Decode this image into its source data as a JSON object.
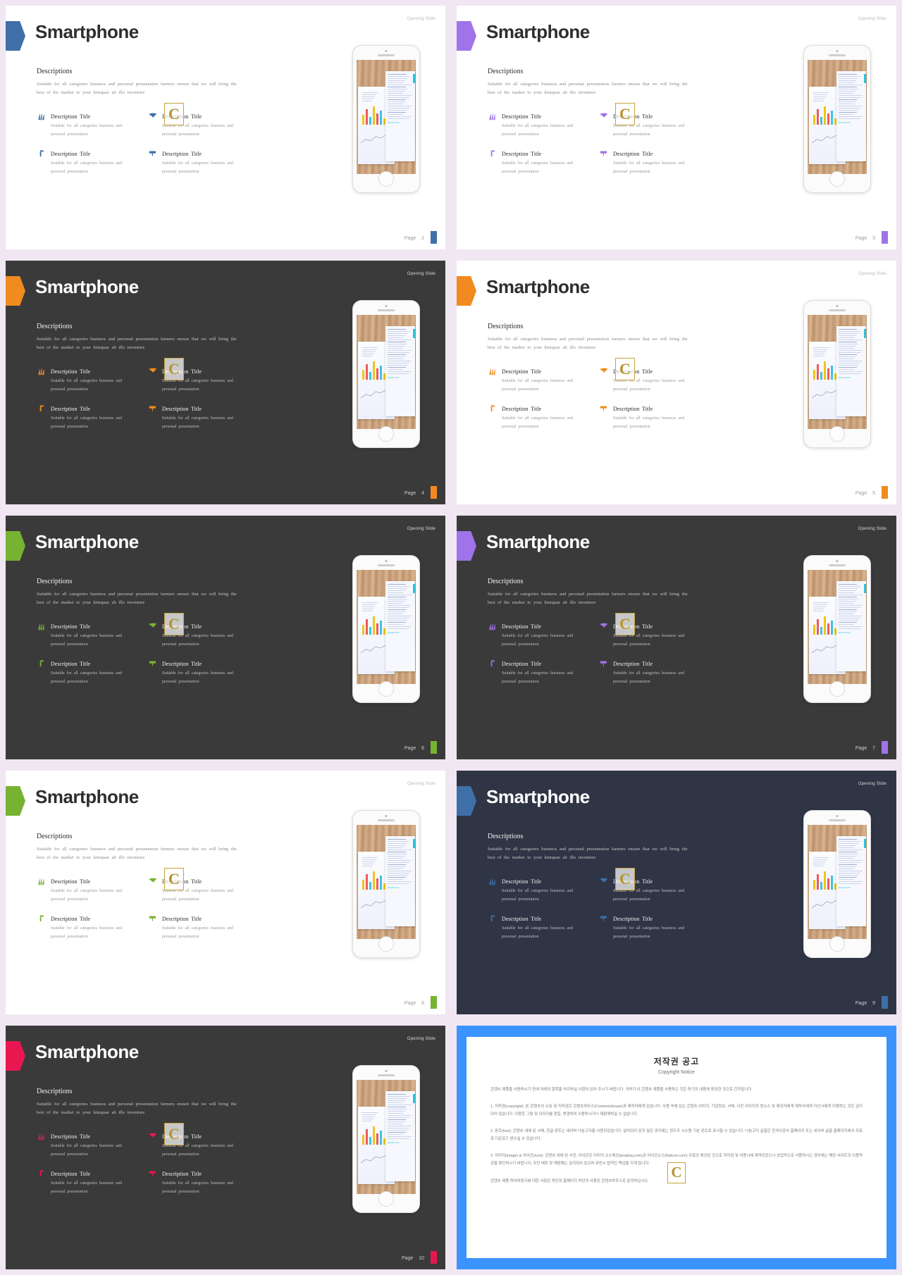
{
  "deck": {
    "slide_title": "Smartphone",
    "opening_tag": "Opening Slide",
    "descriptions_heading": "Descriptions",
    "descriptions_body": "Suitable for all categories  business and personal presentation  farmers ensure that we will  bring the best of the market to your kimquae ab illo inventore",
    "feature_title": "Description Title",
    "feature_body": "Suitable for all categories  business and personal  presentation",
    "watermark_letter": "C",
    "page_word": "Page",
    "feature_icons": [
      "grass-icon",
      "leaf-flag-icon",
      "faucet-icon",
      "paint-roller-icon"
    ]
  },
  "slides": [
    {
      "page": "2",
      "theme": "light",
      "accent": "#3f6fa8",
      "background": "#ffffff"
    },
    {
      "page": "3",
      "theme": "light",
      "accent": "#a073e8",
      "background": "#ffffff"
    },
    {
      "page": "4",
      "theme": "dark",
      "accent": "#f18b1f",
      "background": "#3a3a3a"
    },
    {
      "page": "5",
      "theme": "light",
      "accent": "#f18b1f",
      "background": "#ffffff"
    },
    {
      "page": "6",
      "theme": "dark",
      "accent": "#77b332",
      "background": "#3a3a3a"
    },
    {
      "page": "7",
      "theme": "dark",
      "accent": "#a073e8",
      "background": "#3a3a3a"
    },
    {
      "page": "8",
      "theme": "light",
      "accent": "#77b332",
      "background": "#ffffff"
    },
    {
      "page": "9",
      "theme": "navy",
      "accent": "#3f6fa8",
      "background": "#2f3545"
    },
    {
      "page": "10",
      "theme": "dark",
      "accent": "#e8174f",
      "background": "#3a3a3a"
    }
  ],
  "copyright_slide": {
    "frame_color": "#3b93ff",
    "title_ko": "저작권 공고",
    "title_en": "Copyright Notice",
    "watermark_letter": "C",
    "paragraphs": [
      "콘텐츠 제품을 사용하시기 전에 아래의 항목을 숙지하실 사항이 있어 주시기 바랍니다. 귀하가 이 콘텐츠 제품을 사용하는 것은 하기의 내용에 동의한 것으로 간주됩니다.",
      "1. 저작권(copyright): 본 콘텐츠의 소유 및 저작권은 콘텐츠하우스(ContentsHouse)과 제작자에게 있습니다. 사용 속에 있는 콘텐츠 이미지, 기업정보, 서체, 사진 이미지의 원소스 및 제공자에게 제작사에게 자산시에게 이용하는 것은 금지되어 있습니다. 이용한 그림 및 이미지를 편집, 변경하여 사용하시거나 재판매하실 수 없습니다.",
      "2. 폰트(font): 콘텐츠 내에 된 서체, 한글 폰트는 네이버 나눔고딕을 사용되었습니다. 설치되어 있지 않은 경우에는 윈도우 시스템 기본 폰트로 표시될 수 있습니다. 나눔고딕 글꼴은 한국어공사 홈페이지 또는 네이버 글꼴 홈페이지에서 무료로 다운로드 받으실 수 있습니다.",
      "3. 이미지(image) & 아이콘(icon): 콘텐츠 내에 된 사진, 아이콘은 이미지 소스제공(pixabay.com)과 아이콘소스(flaticon.com) 무료의 제공된 것으로 저작권 및 이용시에 제약되었으나 상업적으로 사용하시는 경우에는 해당 사이트의 이용약관을 확인하시기 바랍니다. 무단 배포 및 재판매는 금지되어 있으며 위반시 법적인 책임을 지게 됩니다.",
      "콘텐츠 제품 하이퍼링크에 대한 사항은 하단의 홈페이지 하단의 사용된 콘텐츠하우스로 문의하십시오."
    ]
  }
}
